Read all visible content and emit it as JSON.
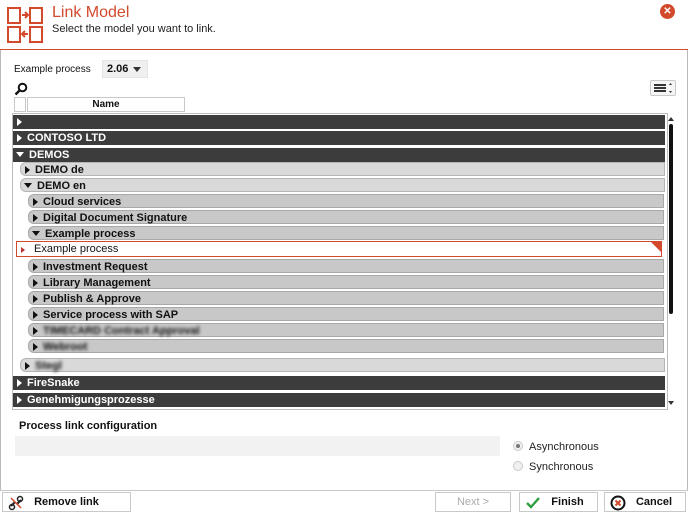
{
  "header": {
    "title": "Link Model",
    "subtitle": "Select the model you want to link.",
    "close_icon": "close-icon",
    "accent_color": "#d2492b"
  },
  "process_selector": {
    "label": "Example process",
    "version": "2.06"
  },
  "table": {
    "column_name": "Name"
  },
  "tree": {
    "root_empty": "",
    "contoso": "CONTOSO LTD",
    "demos": "DEMOS",
    "demo_de": "DEMO de",
    "demo_en": "DEMO en",
    "items_before": [
      "Cloud services",
      "Digital Document Signature"
    ],
    "example_group": "Example process",
    "selected_item": "Example process",
    "items_after": [
      "Investment Request",
      "Library Management",
      "Publish & Approve",
      "Service process with SAP",
      "TIMECARD Contract Approval",
      "Webroot"
    ],
    "stegl": "Stegl",
    "firesnake": "FireSnake",
    "genehmigung": "Genehmigungsprozesse"
  },
  "config": {
    "title": "Process link configuration",
    "options": [
      "Asynchronous",
      "Synchronous"
    ],
    "selected": "Asynchronous"
  },
  "footer": {
    "remove_link": "Remove link",
    "next": "Next >",
    "finish": "Finish",
    "cancel": "Cancel"
  }
}
